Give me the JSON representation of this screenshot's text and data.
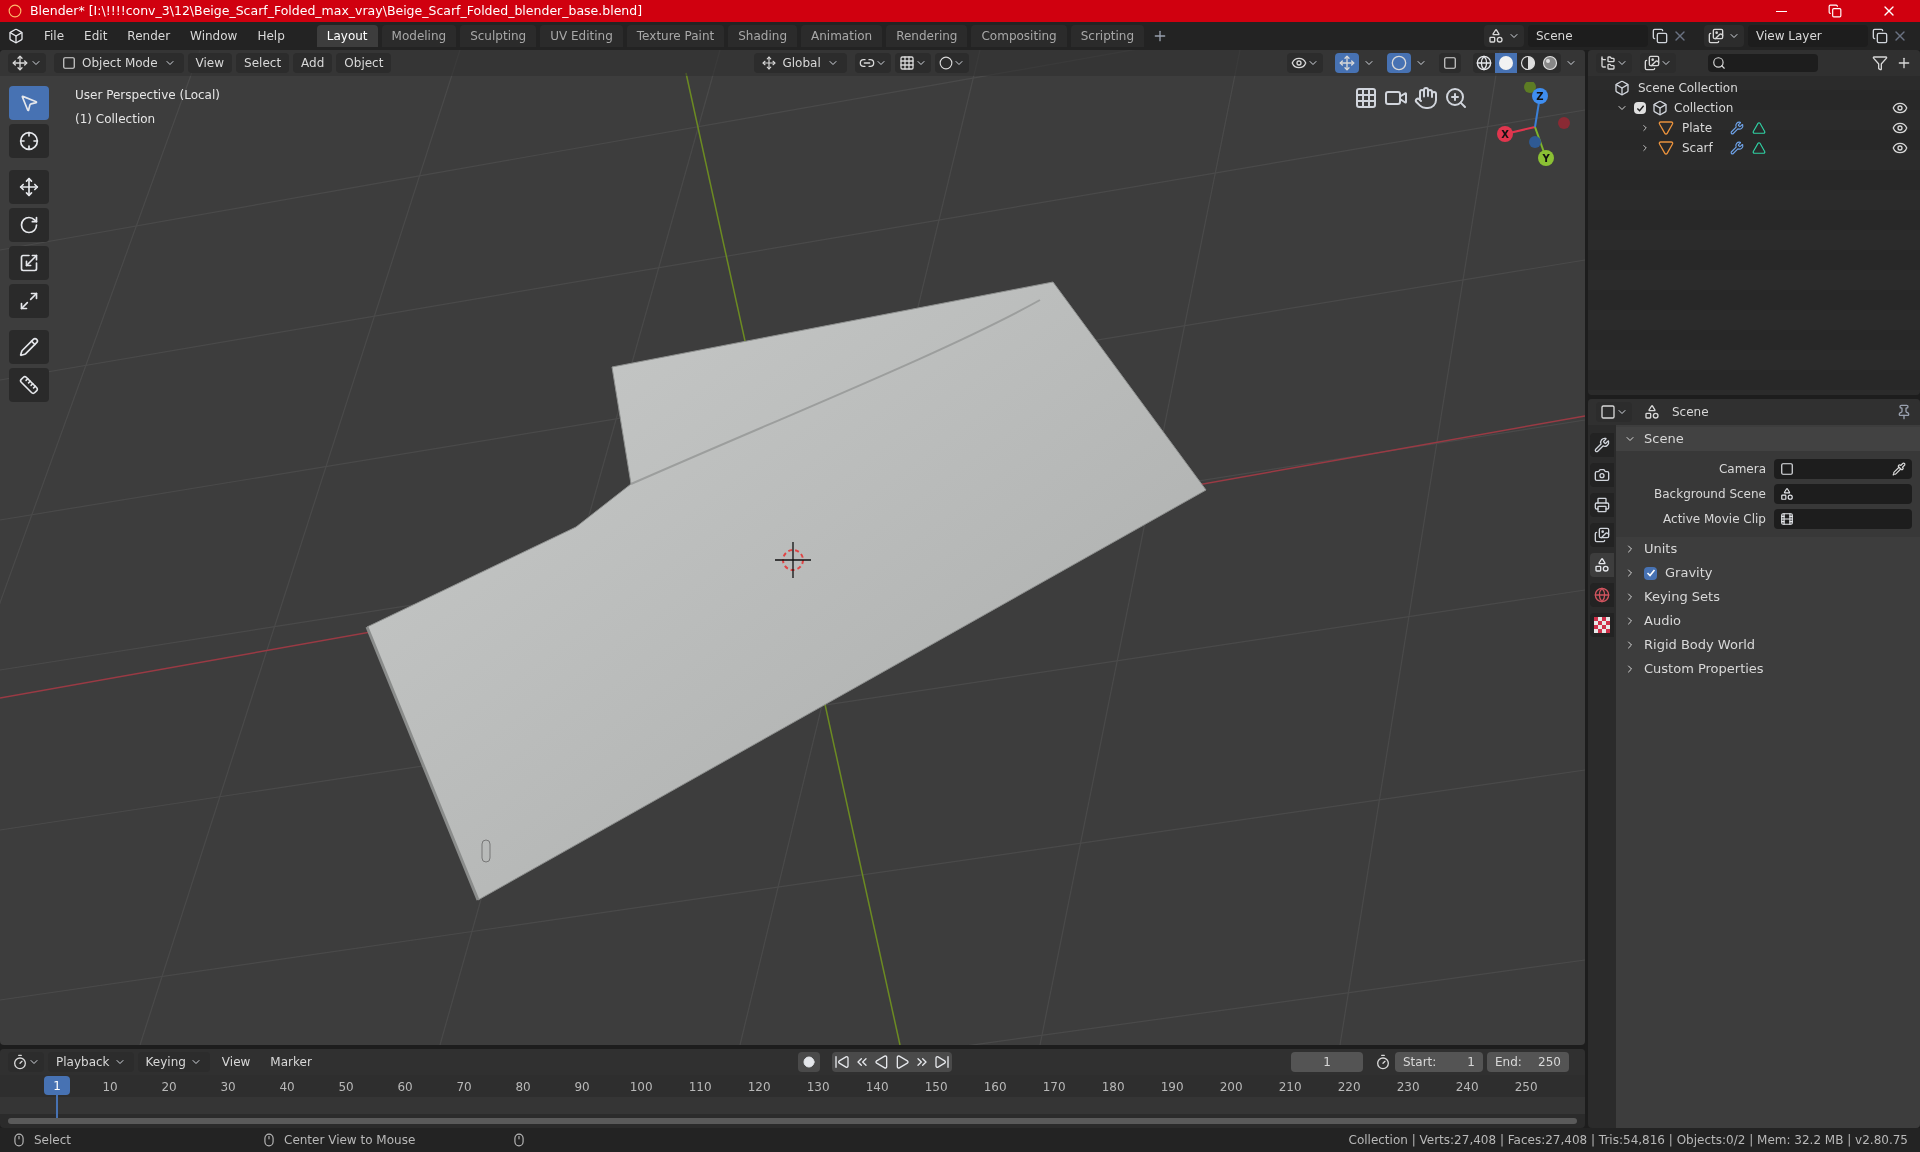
{
  "window": {
    "title": "Blender* [I:\\!!!!conv_3\\12\\Beige_Scarf_Folded_max_vray\\Beige_Scarf_Folded_blender_base.blend]"
  },
  "menu": [
    "File",
    "Edit",
    "Render",
    "Window",
    "Help"
  ],
  "workspaces": [
    {
      "label": "Layout",
      "selected": true
    },
    {
      "label": "Modeling",
      "selected": false
    },
    {
      "label": "Sculpting",
      "selected": false
    },
    {
      "label": "UV Editing",
      "selected": false
    },
    {
      "label": "Texture Paint",
      "selected": false
    },
    {
      "label": "Shading",
      "selected": false
    },
    {
      "label": "Animation",
      "selected": false
    },
    {
      "label": "Rendering",
      "selected": false
    },
    {
      "label": "Compositing",
      "selected": false
    },
    {
      "label": "Scripting",
      "selected": false
    }
  ],
  "scene": {
    "value": "Scene"
  },
  "view_layer": {
    "value": "View Layer"
  },
  "viewport": {
    "mode": "Object Mode",
    "menus": [
      "View",
      "Select",
      "Add",
      "Object"
    ],
    "orientation": "Global",
    "shading": [
      {
        "kind": "wireframe",
        "selected": false
      },
      {
        "kind": "solid",
        "selected": true
      },
      {
        "kind": "material",
        "selected": false
      },
      {
        "kind": "rendered",
        "selected": false
      }
    ],
    "snapping": false,
    "proportional_editing": false,
    "gizmos": true,
    "overlays": true,
    "xray": false,
    "overlay_text": [
      "User Perspective (Local)",
      "(1) Collection"
    ],
    "tools": [
      {
        "kind": "select",
        "selected": true
      },
      {
        "kind": "cursor",
        "selected": false
      },
      {
        "kind": "move",
        "selected": false
      },
      {
        "kind": "rotate",
        "selected": false
      },
      {
        "kind": "scale",
        "selected": false
      },
      {
        "kind": "transform",
        "selected": false
      },
      {
        "kind": "annotate",
        "selected": false
      },
      {
        "kind": "measure",
        "selected": false
      }
    ],
    "gizmo": {
      "x": "X",
      "y": "Y",
      "z": "Z"
    }
  },
  "outliner": {
    "root": "Scene Collection",
    "items": [
      {
        "label": "Collection",
        "checked": true,
        "expanded": true,
        "children": [
          {
            "label": "Plate"
          },
          {
            "label": "Scarf"
          }
        ]
      }
    ]
  },
  "properties": {
    "context": "Scene",
    "tabs": [
      {
        "kind": "tool",
        "selected": false
      },
      {
        "kind": "render",
        "selected": false
      },
      {
        "kind": "output",
        "selected": false
      },
      {
        "kind": "view_layer",
        "selected": false
      },
      {
        "kind": "scene",
        "selected": true
      },
      {
        "kind": "world",
        "selected": false
      },
      {
        "kind": "texture",
        "selected": false
      }
    ],
    "panels": [
      {
        "title": "Scene",
        "expanded": true,
        "fields": [
          {
            "label": "Camera",
            "kind": "object"
          },
          {
            "label": "Background Scene",
            "kind": "scene"
          },
          {
            "label": "Active Movie Clip",
            "kind": "clip"
          }
        ]
      },
      {
        "title": "Units",
        "expanded": false
      },
      {
        "title": "Gravity",
        "expanded": false,
        "checked": true
      },
      {
        "title": "Keying Sets",
        "expanded": false
      },
      {
        "title": "Audio",
        "expanded": false
      },
      {
        "title": "Rigid Body World",
        "expanded": false
      },
      {
        "title": "Custom Properties",
        "expanded": false
      }
    ]
  },
  "timeline": {
    "menus": [
      "Playback",
      "Keying",
      "View",
      "Marker"
    ],
    "current_frame": "1",
    "start_label": "Start:",
    "start": "1",
    "end_label": "End:",
    "end": "250",
    "playhead": "1",
    "ruler": [
      "10",
      "20",
      "30",
      "40",
      "50",
      "60",
      "70",
      "80",
      "90",
      "100",
      "110",
      "120",
      "130",
      "140",
      "150",
      "160",
      "170",
      "180",
      "190",
      "200",
      "210",
      "220",
      "230",
      "240",
      "250"
    ]
  },
  "status_bar": {
    "hints": [
      "Select",
      "Center View to Mouse"
    ],
    "stats": "Collection | Verts:27,408 | Faces:27,408 | Tris:54,816 | Objects:0/2 | Mem: 32.2 MB | v2.80.75"
  }
}
